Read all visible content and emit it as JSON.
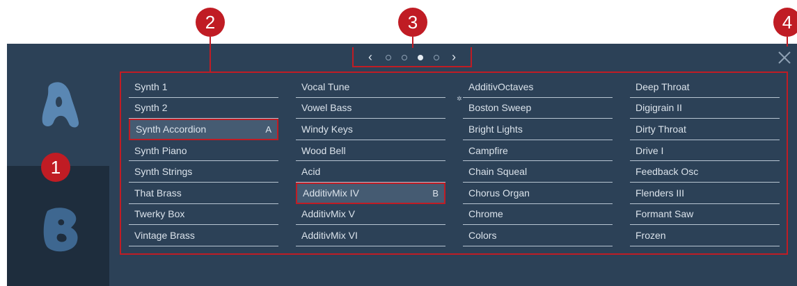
{
  "callouts": [
    "1",
    "2",
    "3",
    "4"
  ],
  "pager": {
    "prev_icon": "chevron-left-icon",
    "next_icon": "chevron-right-icon",
    "pages": 4,
    "active_page": 3,
    "prev_label": "‹",
    "next_label": "›"
  },
  "close_icon": "close-icon",
  "banks": [
    {
      "name": "A",
      "icon": "letter-a-icon",
      "selected": true
    },
    {
      "name": "B",
      "icon": "letter-b-icon",
      "selected": false
    }
  ],
  "columns": [
    {
      "items": [
        {
          "label": "Synth 1",
          "key": ""
        },
        {
          "label": "Synth 2",
          "key": ""
        },
        {
          "label": "Synth Accordion",
          "key": "A",
          "selected": true
        },
        {
          "label": "Synth Piano",
          "key": ""
        },
        {
          "label": "Synth Strings",
          "key": ""
        },
        {
          "label": "That Brass",
          "key": ""
        },
        {
          "label": "Twerky Box",
          "key": ""
        },
        {
          "label": "Vintage Brass",
          "key": ""
        }
      ]
    },
    {
      "items": [
        {
          "label": "Vocal Tune",
          "key": ""
        },
        {
          "label": "Vowel Bass",
          "key": ""
        },
        {
          "label": "Windy Keys",
          "key": ""
        },
        {
          "label": "Wood Bell",
          "key": ""
        },
        {
          "label": "Acid",
          "key": ""
        },
        {
          "label": "AdditivMix IV",
          "key": "B",
          "selected": true
        },
        {
          "label": "AdditivMix V",
          "key": ""
        },
        {
          "label": "AdditivMix VI",
          "key": ""
        }
      ]
    },
    {
      "items": [
        {
          "label": "AdditivOctaves",
          "key": ""
        },
        {
          "label": "Boston Sweep",
          "key": ""
        },
        {
          "label": "Bright Lights",
          "key": ""
        },
        {
          "label": "Campfire",
          "key": ""
        },
        {
          "label": "Chain Squeal",
          "key": ""
        },
        {
          "label": "Chorus Organ",
          "key": ""
        },
        {
          "label": "Chrome",
          "key": ""
        },
        {
          "label": "Colors",
          "key": ""
        }
      ]
    },
    {
      "items": [
        {
          "label": "Deep Throat",
          "key": ""
        },
        {
          "label": "Digigrain II",
          "key": ""
        },
        {
          "label": "Dirty Throat",
          "key": ""
        },
        {
          "label": "Drive I",
          "key": ""
        },
        {
          "label": "Feedback Osc",
          "key": ""
        },
        {
          "label": "Flenders III",
          "key": ""
        },
        {
          "label": "Formant Saw",
          "key": ""
        },
        {
          "label": "Frozen",
          "key": ""
        }
      ]
    }
  ],
  "colors": {
    "panel": "#2c4157",
    "panel_dark": "#1e2d3d",
    "callout": "#c01c24",
    "item_text": "#dbe3eb",
    "selected_bg": "#455b72",
    "letter": "#5a87b3",
    "letter_dark": "#3e6790"
  }
}
